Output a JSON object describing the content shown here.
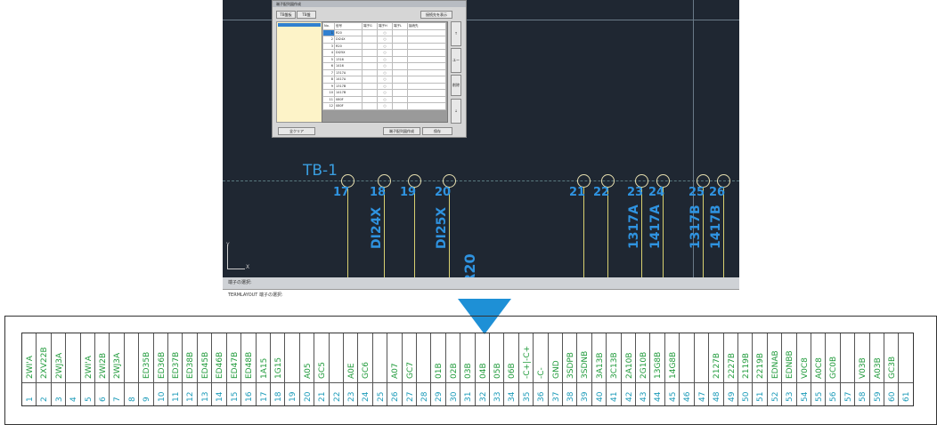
{
  "cad": {
    "panel_label": "TB-1",
    "cable_label": "R20",
    "terminals": [
      {
        "num": "17",
        "label": ""
      },
      {
        "num": "18",
        "label": "DI24X"
      },
      {
        "num": "19",
        "label": ""
      },
      {
        "num": "20",
        "label": "DI25X"
      },
      {
        "num": "21",
        "label": ""
      },
      {
        "num": "22",
        "label": ""
      },
      {
        "num": "23",
        "label": "1317A"
      },
      {
        "num": "24",
        "label": "1417A"
      },
      {
        "num": "25",
        "label": "1317B"
      },
      {
        "num": "26",
        "label": "1417B"
      }
    ],
    "command_history": "端子の選択:",
    "command_input": "TERMLAYOUT 端子の選択:",
    "axis_x": "X",
    "axis_y": "Y"
  },
  "dialog": {
    "title": "端子配列図作成",
    "tabs": [
      "TB盤板",
      "TB盤"
    ],
    "show_destination_button": "接続先を表示",
    "columns": [
      "No.",
      "信号",
      "端子G",
      "端子H",
      "端子L",
      "接続先"
    ],
    "rows": [
      {
        "no": "1",
        "signal": "R20",
        "h": "○"
      },
      {
        "no": "2",
        "signal": "DI24X",
        "h": "○"
      },
      {
        "no": "3",
        "signal": "R20",
        "h": "○"
      },
      {
        "no": "4",
        "signal": "DI25X",
        "h": "○"
      },
      {
        "no": "5",
        "signal": "1316",
        "h": "○"
      },
      {
        "no": "6",
        "signal": "1416",
        "h": "○"
      },
      {
        "no": "7",
        "signal": "1317A",
        "h": "○"
      },
      {
        "no": "8",
        "signal": "1417A",
        "h": "○"
      },
      {
        "no": "9",
        "signal": "1317B",
        "h": "○"
      },
      {
        "no": "10",
        "signal": "1417B",
        "h": "○"
      },
      {
        "no": "11",
        "signal": "080F",
        "h": "○"
      },
      {
        "no": "12",
        "signal": "080F",
        "h": "○"
      }
    ],
    "side_buttons": [
      "↑",
      "ユーザー",
      "削除",
      "↓"
    ],
    "clear_all_button": "全クリア",
    "create_button": "端子配列図作成",
    "save_button": "保存"
  },
  "terminal_table": {
    "names": [
      "2WI'A",
      "2XV22B",
      "2WJ3A",
      "",
      "2WI'A",
      "2WI2B",
      "2WJ3A",
      "",
      "ED35B",
      "ED36B",
      "ED37B",
      "ED38B",
      "ED45B",
      "ED46B",
      "ED47B",
      "ED48B",
      "1A15",
      "1G15",
      "",
      "A05",
      "GC5",
      "",
      "A0E",
      "GC6",
      "",
      "A07",
      "GC7",
      "",
      "01B",
      "02B",
      "03B",
      "04B",
      "05B",
      "06B",
      "-C+|-C+",
      "-C-",
      "GND",
      "3SDPB",
      "3SDNB",
      "3A13B",
      "3C13B",
      "2A10B",
      "2G10B",
      "13G8B",
      "14G8B",
      "",
      "",
      "2127B",
      "2227B",
      "2119B",
      "2219B",
      "EDNAB",
      "EDNBB",
      "V0C8",
      "A0C8",
      "GC0B",
      "",
      "V03B",
      "A03B",
      "GC3B",
      ""
    ],
    "numbers": [
      "1",
      "2",
      "3",
      "4",
      "5",
      "6",
      "7",
      "8",
      "9",
      "10",
      "11",
      "12",
      "13",
      "14",
      "15",
      "16",
      "17",
      "18",
      "19",
      "20",
      "21",
      "22",
      "23",
      "24",
      "25",
      "26",
      "27",
      "28",
      "29",
      "30",
      "31",
      "32",
      "33",
      "34",
      "35",
      "36",
      "37",
      "38",
      "39",
      "40",
      "41",
      "42",
      "43",
      "44",
      "45",
      "46",
      "47",
      "48",
      "49",
      "50",
      "51",
      "52",
      "53",
      "54",
      "55",
      "56",
      "57",
      "58",
      "59",
      "60",
      "61"
    ]
  },
  "colors": {
    "cad_background": "#1f2732",
    "terminal_label": "#2f93e0",
    "wire": "#d8d070",
    "name_text": "#1f9a3a",
    "number_text": "#1a9ab8",
    "arrow": "#1e90d6"
  }
}
